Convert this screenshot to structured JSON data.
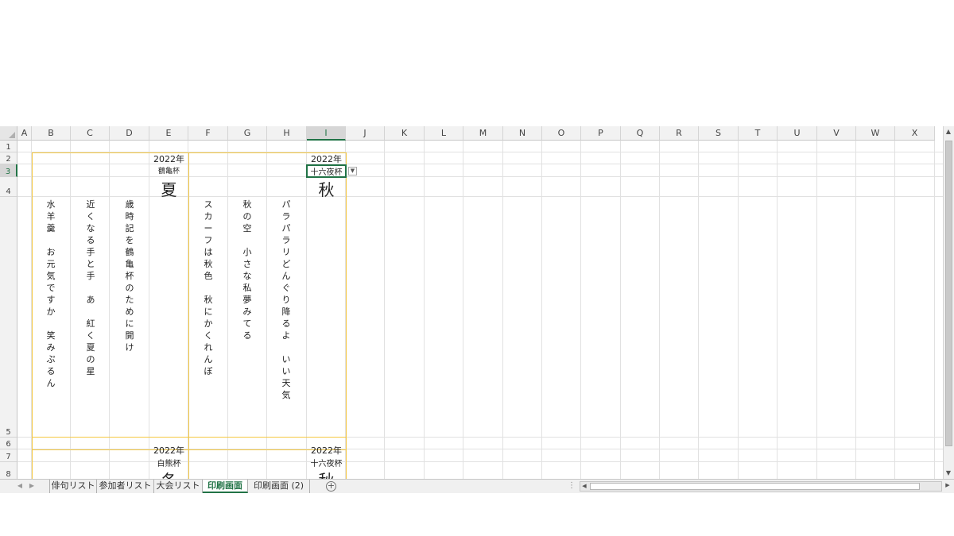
{
  "columns": [
    "A",
    "B",
    "C",
    "D",
    "E",
    "F",
    "G",
    "H",
    "I",
    "J",
    "K",
    "L",
    "M",
    "N",
    "O",
    "P",
    "Q",
    "R",
    "S",
    "T",
    "U",
    "V",
    "W",
    "X"
  ],
  "selected_column": "I",
  "rows": [
    "1",
    "2",
    "3",
    "4",
    "5",
    "6",
    "7",
    "8"
  ],
  "selected_row": "3",
  "cards": {
    "top_left": {
      "year": "2022年",
      "contest": "鶴亀杯",
      "season": "夏"
    },
    "top_right": {
      "year": "2022年",
      "contest": "十六夜杯",
      "season": "秋"
    },
    "bottom_left": {
      "year": "2022年",
      "contest": "白熊杯",
      "season": "冬"
    },
    "bottom_right": {
      "year": "2022年",
      "contest": "十六夜杯",
      "season": "秋"
    }
  },
  "haiku": [
    {
      "col": "B",
      "text": "水羊羹　お元気ですか　笑みぷるん"
    },
    {
      "col": "C",
      "text": "近くなる手と手　あ　紅く夏の星"
    },
    {
      "col": "D",
      "text": "歳時記を鶴亀杯のために開け"
    },
    {
      "col": "F",
      "text": "スカーフは秋色　秋にかくれんぼ"
    },
    {
      "col": "G",
      "text": "秋の空　小さな私夢みてる"
    },
    {
      "col": "H",
      "text": "パラパラリどんぐり降るよ　いい天気"
    }
  ],
  "sheet_tabs": [
    "俳句リスト",
    "参加者リスト",
    "大会リスト",
    "印刷画面",
    "印刷画面 (2)"
  ],
  "active_tab": "印刷画面",
  "icons": {
    "tab_prev": "triangle-left-icon",
    "tab_next": "triangle-right-icon",
    "add_sheet": "plus-circle-icon",
    "dropdown": "chevron-down-icon"
  },
  "colors": {
    "accent": "#217346",
    "card_border": "#f5c842",
    "grid": "#e1e1e1"
  }
}
